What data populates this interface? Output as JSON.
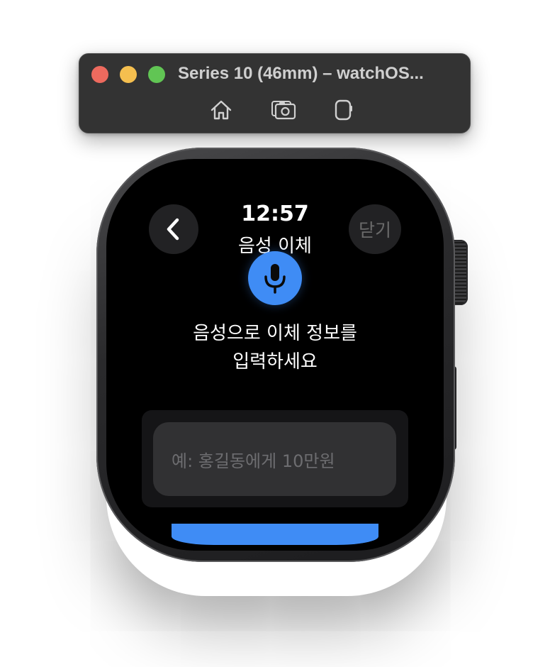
{
  "window": {
    "title": "Series 10 (46mm) – watchOS...",
    "buttons": {
      "close_color": "#ed6a5e",
      "minimize_color": "#f5bf4f",
      "maximize_color": "#61c554"
    },
    "toolbar": {
      "home_icon": "home-icon",
      "screenshot_icon": "camera-icon",
      "rotate_icon": "rotate-device-icon"
    }
  },
  "watch": {
    "time": "12:57",
    "nav_title": "음성 이체",
    "back_icon": "chevron-left-icon",
    "close_label": "닫기",
    "mic_icon": "microphone-icon",
    "prompt_lines": [
      "음성으로 이체 정보를",
      "입력하세요"
    ],
    "input_placeholder": "예: 홍길동에게 10만원",
    "accent_color": "#3f8cf5"
  }
}
